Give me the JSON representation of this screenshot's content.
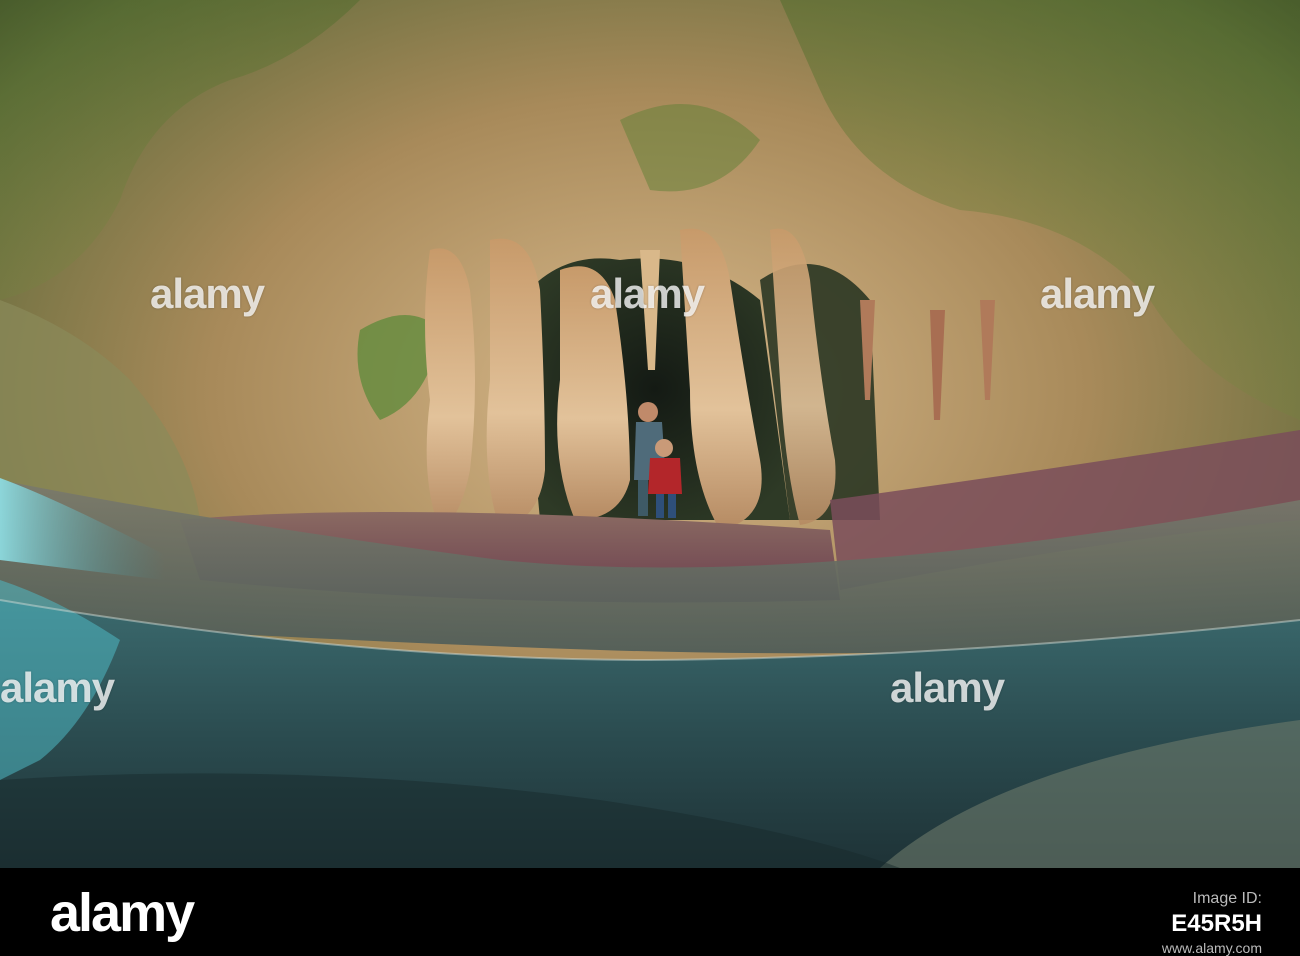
{
  "watermark": {
    "text": "alamy"
  },
  "footer": {
    "logo": "alamy",
    "label": "Image ID:",
    "image_id": "E45R5H",
    "alt_text": "www.alamy.com"
  },
  "colors": {
    "cave_rock": "#b8946a",
    "moss": "#6b8a3c",
    "water_surface": "#5c6c66",
    "underwater": "#2f5a5f",
    "footer_bg": "#000000"
  }
}
